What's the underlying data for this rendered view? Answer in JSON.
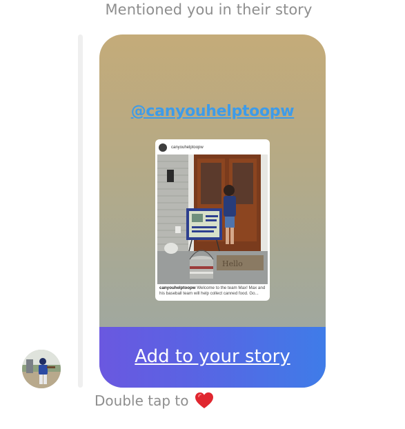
{
  "header": {
    "mention_text": "Mentioned you in their story"
  },
  "story": {
    "mention_handle": "@canyouhelptoopw",
    "post": {
      "username": "canyouhelptoopw",
      "caption_user": "canyouhelptoopw",
      "caption_text": "Welcome to the team Max! Max and his baseball team will help collect canned food. Go..."
    },
    "add_to_story_label": "Add to your story"
  },
  "footer": {
    "double_tap_text": "Double tap to",
    "heart_icon": "red-heart-icon",
    "heart_color": "#e0262f"
  },
  "colors": {
    "mention_link": "#3d9be9",
    "add_story_gradient_start": "#6a58e0",
    "add_story_gradient_end": "#3f7ce8",
    "secondary_text": "#8e8e8e"
  }
}
